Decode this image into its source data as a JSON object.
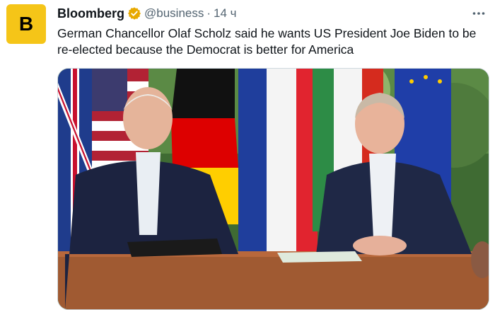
{
  "account": {
    "avatar_letter": "B",
    "name": "Bloomberg",
    "handle": "@business",
    "separator": "·",
    "time": "14 ч"
  },
  "tweet": {
    "text": "German Chancellor Olaf Scholz said he wants US President Joe Biden to be re-elected because the Democrat is better for America"
  },
  "icons": {
    "verified": "verified-badge-icon",
    "more": "more-options-icon"
  },
  "colors": {
    "brand": "#f5c518",
    "verified": "#e8a900",
    "text": "#0f1419",
    "muted": "#536471"
  }
}
